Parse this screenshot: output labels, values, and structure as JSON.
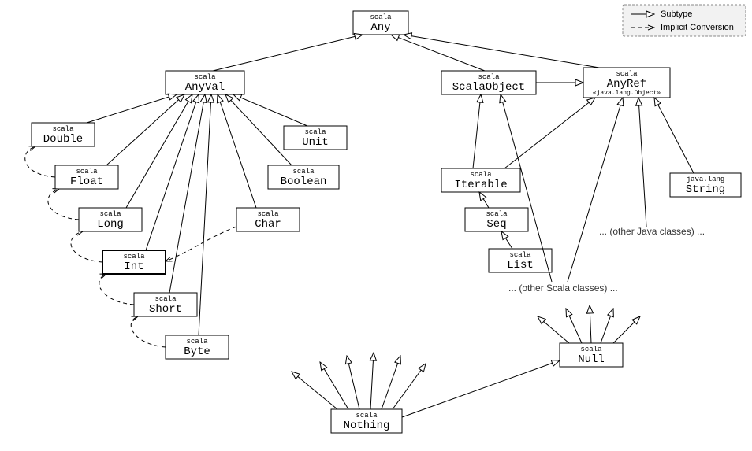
{
  "legend": {
    "subtype": "Subtype",
    "implicit": "Implicit Conversion"
  },
  "notes": {
    "otherJava": "... (other Java classes) ...",
    "otherScala": "... (other Scala classes) ..."
  },
  "nodes": {
    "Any": {
      "pkg": "scala",
      "name": "Any",
      "sub": ""
    },
    "AnyVal": {
      "pkg": "scala",
      "name": "AnyVal",
      "sub": ""
    },
    "ScalaObject": {
      "pkg": "scala",
      "name": "ScalaObject",
      "sub": ""
    },
    "AnyRef": {
      "pkg": "scala",
      "name": "AnyRef",
      "sub": "«java.lang.Object»"
    },
    "Double": {
      "pkg": "scala",
      "name": "Double",
      "sub": ""
    },
    "Float": {
      "pkg": "scala",
      "name": "Float",
      "sub": ""
    },
    "Long": {
      "pkg": "scala",
      "name": "Long",
      "sub": ""
    },
    "Int": {
      "pkg": "scala",
      "name": "Int",
      "sub": ""
    },
    "Short": {
      "pkg": "scala",
      "name": "Short",
      "sub": ""
    },
    "Byte": {
      "pkg": "scala",
      "name": "Byte",
      "sub": ""
    },
    "Unit": {
      "pkg": "scala",
      "name": "Unit",
      "sub": ""
    },
    "Boolean": {
      "pkg": "scala",
      "name": "Boolean",
      "sub": ""
    },
    "Char": {
      "pkg": "scala",
      "name": "Char",
      "sub": ""
    },
    "Iterable": {
      "pkg": "scala",
      "name": "Iterable",
      "sub": ""
    },
    "Seq": {
      "pkg": "scala",
      "name": "Seq",
      "sub": ""
    },
    "List": {
      "pkg": "scala",
      "name": "List",
      "sub": ""
    },
    "String": {
      "pkg": "java.lang",
      "name": "String",
      "sub": ""
    },
    "Null": {
      "pkg": "scala",
      "name": "Null",
      "sub": ""
    },
    "Nothing": {
      "pkg": "scala",
      "name": "Nothing",
      "sub": ""
    }
  }
}
